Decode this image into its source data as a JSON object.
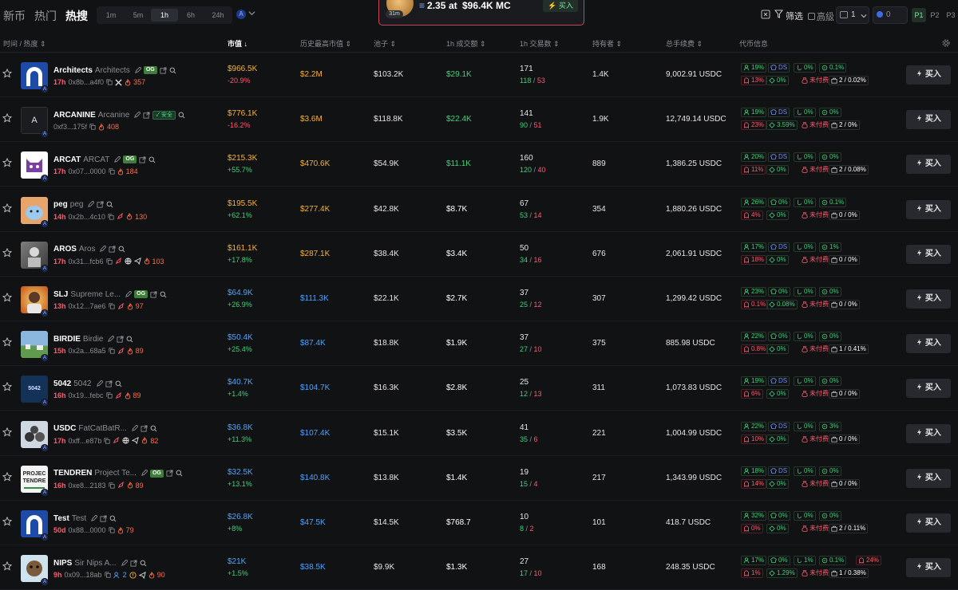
{
  "nav": {
    "tabs": [
      "新币",
      "热门",
      "热搜"
    ],
    "active_tab": "热搜"
  },
  "timeframes": {
    "items": [
      "1m",
      "5m",
      "1h",
      "6h",
      "24h"
    ],
    "active": "1h"
  },
  "trade_popup": {
    "age": "31m",
    "amount": "2.35",
    "at_label": "at",
    "mc": "$96.4K MC",
    "buy_label": "买入"
  },
  "toolbar": {
    "filter_label": "筛选",
    "advanced_label": "高级",
    "quantity": "1",
    "sol_value": "0",
    "presets": [
      "P1",
      "P2",
      "P3"
    ],
    "active_preset": "P1"
  },
  "columns": {
    "time": "时间",
    "heat": "热度",
    "mc": "市值",
    "ath": "历史最高市值",
    "pool": "池子",
    "vol": "1h 成交额",
    "txns": "1h 交易数",
    "holders": "持有者",
    "fees": "总手续费",
    "info": "代币信息"
  },
  "colors": {
    "green": "#3fd17b",
    "red": "#ff5a6e",
    "orange": "#f7b23b",
    "blue": "#4da3ff",
    "bg": "#111214"
  },
  "rows": [
    {
      "symbol": "Architects",
      "name": "Architects",
      "og": true,
      "safe": false,
      "age": "17h",
      "addr": "0x8b...a4f0",
      "extras": [
        "copy",
        "x-icon"
      ],
      "heat": "357",
      "mc": "$966.5K",
      "change": "-20.9%",
      "change_color": "red",
      "ath": "$2.2M",
      "ath_color": "orange",
      "pool": "$103.2K",
      "vol": "$29.1K",
      "vol_color": "green",
      "txns": "171",
      "buys": "118",
      "sells": "53",
      "holders": "1.4K",
      "fees": "9,002.91 USDC",
      "stats": {
        "top10": "19%",
        "ds": "DS",
        "dev": "0%",
        "snipers": "0.1%",
        "insiders": "13%",
        "bundled": "0%",
        "paid": "未付费",
        "lp": "2 / 0.02%"
      },
      "avatar": "arch"
    },
    {
      "symbol": "ARCANINE",
      "name": "Arcanine",
      "og": false,
      "safe": true,
      "safe_label": "安全",
      "age": "",
      "addr": "0xf3...175f",
      "extras": [
        "copy"
      ],
      "heat": "408",
      "mc": "$776.1K",
      "change": "-16.2%",
      "change_color": "red",
      "ath": "$3.6M",
      "ath_color": "orange",
      "pool": "$118.8K",
      "vol": "$22.4K",
      "vol_color": "green",
      "txns": "141",
      "buys": "90",
      "sells": "51",
      "holders": "1.9K",
      "fees": "12,749.14 USDC",
      "stats": {
        "top10": "19%",
        "ds": "DS",
        "dev": "0%",
        "snipers": "0%",
        "insiders": "23%",
        "bundled": "3.59%",
        "paid": "未付费",
        "lp": "2 / 0%"
      },
      "avatar": "letter"
    },
    {
      "symbol": "ARCAT",
      "name": "ARCAT",
      "og": true,
      "safe": false,
      "age": "17h",
      "addr": "0x07...0000",
      "extras": [
        "copy"
      ],
      "heat": "184",
      "mc": "$215.3K",
      "change": "+55.7%",
      "change_color": "green",
      "ath": "$470.6K",
      "ath_color": "orange",
      "pool": "$54.9K",
      "vol": "$11.1K",
      "vol_color": "green",
      "txns": "160",
      "buys": "120",
      "sells": "40",
      "holders": "889",
      "fees": "1,386.25 USDC",
      "stats": {
        "top10": "20%",
        "ds": "DS",
        "dev": "0%",
        "snipers": "0%",
        "insiders": "11%",
        "bundled": "0%",
        "paid": "未付费",
        "lp": "2 / 0.08%"
      },
      "avatar": "cat"
    },
    {
      "symbol": "peg",
      "name": "peg",
      "og": false,
      "safe": false,
      "age": "14h",
      "addr": "0x2b...4c10",
      "extras": [
        "copy",
        "rocket"
      ],
      "heat": "130",
      "mc": "$195.5K",
      "change": "+62.1%",
      "change_color": "green",
      "ath": "$277.4K",
      "ath_color": "orange",
      "pool": "$42.8K",
      "vol": "$8.7K",
      "vol_color": "white",
      "txns": "67",
      "buys": "53",
      "sells": "14",
      "holders": "354",
      "fees": "1,880.26 USDC",
      "stats": {
        "top10": "26%",
        "ds": "",
        "dev": "0%",
        "snipers": "0.1%",
        "insiders": "4%",
        "bundled": "0%",
        "paid": "未付费",
        "lp": "0 / 0%"
      },
      "avatar": "peg"
    },
    {
      "symbol": "AROS",
      "name": "Aros",
      "og": false,
      "safe": false,
      "age": "17h",
      "addr": "0x31...fcb6",
      "extras": [
        "copy",
        "rocket",
        "globe",
        "telegram"
      ],
      "heat": "103",
      "mc": "$161.1K",
      "change": "+17.8%",
      "change_color": "green",
      "ath": "$287.1K",
      "ath_color": "orange",
      "pool": "$38.4K",
      "vol": "$3.4K",
      "vol_color": "white",
      "txns": "50",
      "buys": "34",
      "sells": "16",
      "holders": "676",
      "fees": "2,061.91 USDC",
      "stats": {
        "top10": "17%",
        "ds": "DS",
        "dev": "0%",
        "snipers": "1%",
        "insiders": "18%",
        "bundled": "0%",
        "paid": "未付费",
        "lp": "0 / 0%"
      },
      "avatar": "aros"
    },
    {
      "symbol": "SLJ",
      "name": "Supreme Le...",
      "og": true,
      "safe": false,
      "age": "13h",
      "addr": "0x12...7ae6",
      "extras": [
        "copy",
        "rocket"
      ],
      "heat": "97",
      "mc": "$64.9K",
      "change": "+26.9%",
      "change_color": "green",
      "ath": "$111.3K",
      "ath_color": "blue",
      "pool": "$22.1K",
      "vol": "$2.7K",
      "vol_color": "white",
      "txns": "37",
      "buys": "25",
      "sells": "12",
      "holders": "307",
      "fees": "1,299.42 USDC",
      "stats": {
        "top10": "23%",
        "ds": "",
        "dev": "0%",
        "snipers": "0%",
        "insiders": "0.1%",
        "bundled": "0.08%",
        "paid": "未付费",
        "lp": "0 / 0%"
      },
      "avatar": "slj"
    },
    {
      "symbol": "BIRDIE",
      "name": "Birdie",
      "og": false,
      "safe": false,
      "age": "15h",
      "addr": "0x2a...68a5",
      "extras": [
        "copy",
        "rocket"
      ],
      "heat": "89",
      "mc": "$50.4K",
      "change": "+25.4%",
      "change_color": "green",
      "ath": "$87.4K",
      "ath_color": "blue",
      "pool": "$18.8K",
      "vol": "$1.9K",
      "vol_color": "white",
      "txns": "37",
      "buys": "27",
      "sells": "10",
      "holders": "375",
      "fees": "885.98 USDC",
      "stats": {
        "top10": "22%",
        "ds": "",
        "dev": "0%",
        "snipers": "0%",
        "insiders": "0.8%",
        "bundled": "0%",
        "paid": "未付费",
        "lp": "1 / 0.41%"
      },
      "avatar": "birdie"
    },
    {
      "symbol": "5042",
      "name": "5042",
      "og": false,
      "safe": false,
      "age": "16h",
      "addr": "0x19...febc",
      "extras": [
        "copy",
        "rocket"
      ],
      "heat": "89",
      "mc": "$40.7K",
      "change": "+1.4%",
      "change_color": "green",
      "ath": "$104.7K",
      "ath_color": "blue",
      "pool": "$16.3K",
      "vol": "$2.8K",
      "vol_color": "white",
      "txns": "25",
      "buys": "12",
      "sells": "13",
      "holders": "311",
      "fees": "1,073.83 USDC",
      "stats": {
        "top10": "19%",
        "ds": "DS",
        "dev": "0%",
        "snipers": "0%",
        "insiders": "6%",
        "bundled": "0%",
        "paid": "未付费",
        "lp": "0 / 0%"
      },
      "avatar": "5042"
    },
    {
      "symbol": "USDC",
      "name": "FatCatBatR...",
      "og": false,
      "safe": false,
      "age": "17h",
      "addr": "0xff...e87b",
      "extras": [
        "copy",
        "rocket",
        "globe",
        "telegram"
      ],
      "heat": "82",
      "mc": "$36.8K",
      "change": "+11.3%",
      "change_color": "green",
      "ath": "$107.4K",
      "ath_color": "blue",
      "pool": "$15.1K",
      "vol": "$3.5K",
      "vol_color": "white",
      "txns": "41",
      "buys": "35",
      "sells": "6",
      "holders": "221",
      "fees": "1,004.99 USDC",
      "stats": {
        "top10": "22%",
        "ds": "DS",
        "dev": "0%",
        "snipers": "3%",
        "insiders": "10%",
        "bundled": "0%",
        "paid": "未付费",
        "lp": "0 / 0%"
      },
      "avatar": "usdc"
    },
    {
      "symbol": "TENDREN",
      "name": "Project Te...",
      "og": true,
      "safe": false,
      "age": "16h",
      "addr": "0xe8...2183",
      "extras": [
        "copy",
        "rocket"
      ],
      "heat": "89",
      "mc": "$32.5K",
      "change": "+13.1%",
      "change_color": "green",
      "ath": "$140.8K",
      "ath_color": "blue",
      "pool": "$13.8K",
      "vol": "$1.4K",
      "vol_color": "white",
      "txns": "19",
      "buys": "15",
      "sells": "4",
      "holders": "217",
      "fees": "1,343.99 USDC",
      "stats": {
        "top10": "18%",
        "ds": "DS",
        "dev": "0%",
        "snipers": "0%",
        "insiders": "14%",
        "bundled": "0%",
        "paid": "未付费",
        "lp": "0 / 0%"
      },
      "avatar": "tendren",
      "avatar_text": "PROJEC TENDRE"
    },
    {
      "symbol": "Test",
      "name": "Test",
      "og": false,
      "safe": false,
      "age": "50d",
      "addr": "0x88...0000",
      "extras": [
        "copy"
      ],
      "heat": "79",
      "mc": "$26.8K",
      "change": "+8%",
      "change_color": "green",
      "ath": "$47.5K",
      "ath_color": "blue",
      "pool": "$14.5K",
      "vol": "$768.7",
      "vol_color": "white",
      "txns": "10",
      "buys": "8",
      "sells": "2",
      "holders": "101",
      "fees": "418.7 USDC",
      "stats": {
        "top10": "32%",
        "ds": "",
        "dev": "0%",
        "snipers": "0%",
        "insiders": "0%",
        "bundled": "0%",
        "paid": "未付费",
        "lp": "2 / 0.11%"
      },
      "avatar": "arch"
    },
    {
      "symbol": "NIPS",
      "name": "Sir Nips A...",
      "og": false,
      "safe": false,
      "age": "9h",
      "addr": "0x09...18ab",
      "extras": [
        "copy",
        "users"
      ],
      "users_count": "2",
      "extras2": [
        "warn",
        "telegram"
      ],
      "heat": "90",
      "mc": "$21K",
      "change": "+1.5%",
      "change_color": "green",
      "ath": "$38.5K",
      "ath_color": "blue",
      "pool": "$9.9K",
      "vol": "$1.3K",
      "vol_color": "white",
      "txns": "27",
      "buys": "17",
      "sells": "10",
      "holders": "168",
      "fees": "248.35 USDC",
      "stats": {
        "top10": "17%",
        "ds": "",
        "dev": "1%",
        "snipers": "0.1%",
        "extra": "24%",
        "insiders": "1%",
        "bundled": "1.29%",
        "paid": "未付费",
        "lp": "1 / 0.38%"
      },
      "avatar": "nips"
    }
  ],
  "buy_label": "买入"
}
